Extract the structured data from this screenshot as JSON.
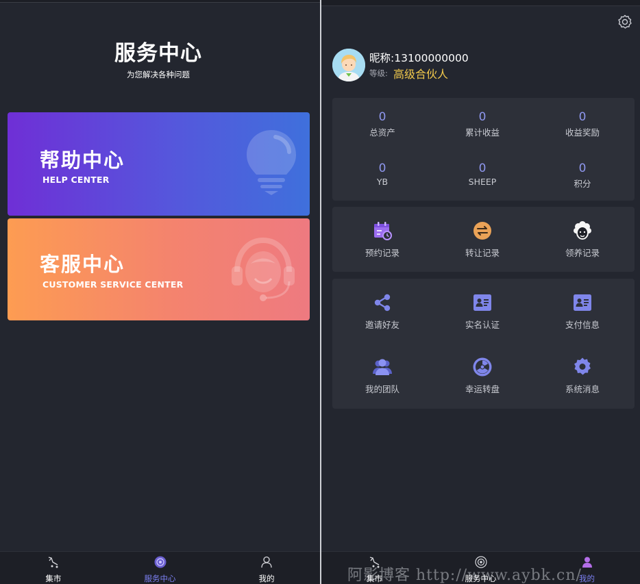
{
  "service_center": {
    "title": "服务中心",
    "subtitle": "为您解决各种问题",
    "help_card": {
      "title": "帮助中心",
      "subtitle": "HELP CENTER",
      "icon": "lightbulb-icon"
    },
    "cs_card": {
      "title": "客服中心",
      "subtitle": "CUSTOMER SERVICE CENTER",
      "icon": "headset-agent-icon"
    }
  },
  "tabbar": [
    {
      "label": "集市",
      "icon": "market-icon"
    },
    {
      "label": "服务中心",
      "icon": "service-icon",
      "active": true
    },
    {
      "label": "我的",
      "icon": "user-icon"
    }
  ],
  "profile": {
    "nickname": "昵称:13100000000",
    "level_label": "等级:",
    "level_value": "高级合伙人",
    "avatar": "avatar-icon",
    "settings_icon": "gear-icon"
  },
  "stats": [
    {
      "value": "0",
      "label": "总资产"
    },
    {
      "value": "0",
      "label": "累计收益"
    },
    {
      "value": "0",
      "label": "收益奖励"
    },
    {
      "value": "0",
      "label": "YB"
    },
    {
      "value": "0",
      "label": "SHEEP"
    },
    {
      "value": "0",
      "label": "积分"
    }
  ],
  "records": [
    {
      "label": "预约记录",
      "icon": "calendar-clock-icon"
    },
    {
      "label": "转让记录",
      "icon": "transfer-arrows-icon"
    },
    {
      "label": "领养记录",
      "icon": "sheep-icon"
    }
  ],
  "menu": [
    {
      "label": "邀请好友",
      "icon": "share-icon"
    },
    {
      "label": "实名认证",
      "icon": "id-card-icon"
    },
    {
      "label": "支付信息",
      "icon": "id-card-icon"
    },
    {
      "label": "我的团队",
      "icon": "team-icon"
    },
    {
      "label": "幸运转盘",
      "icon": "lucky-wheel-icon"
    },
    {
      "label": "系统消息",
      "icon": "gear-icon"
    }
  ],
  "right_tabbar": [
    {
      "label": "集市",
      "icon": "market-icon"
    },
    {
      "label": "服务中心",
      "icon": "service-icon"
    },
    {
      "label": "我的",
      "icon": "user-icon",
      "active": true
    }
  ],
  "watermark": "阿影博客 http://www.aybk.cn/",
  "colors": {
    "accent": "#7b7ff0",
    "gold": "#f2c94c",
    "background": "#23262f",
    "panel": "#2d3039"
  }
}
